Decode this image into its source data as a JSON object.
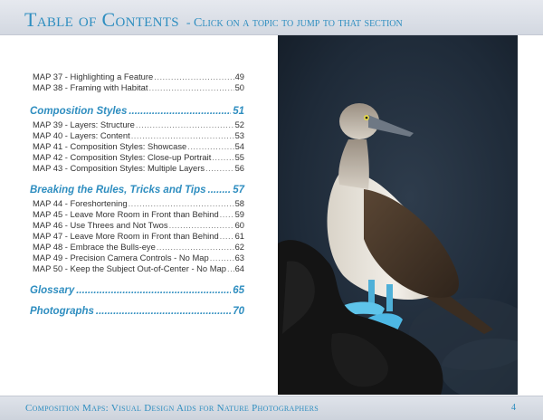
{
  "header": {
    "title": "Table of Contents",
    "subtitle": "- Click on a topic to jump to that section"
  },
  "toc": {
    "intro_entries": [
      {
        "label": "MAP 37 - Highlighting a Feature",
        "page": "49"
      },
      {
        "label": "MAP 38 - Framing with Habitat",
        "page": "50"
      }
    ],
    "sections": [
      {
        "title": "Composition Styles",
        "page": "51",
        "entries": [
          {
            "label": "MAP 39 - Layers: Structure",
            "page": "52"
          },
          {
            "label": "MAP 40 - Layers: Content",
            "page": "53"
          },
          {
            "label": "MAP 41 - Composition Styles: Showcase",
            "page": "54"
          },
          {
            "label": "MAP 42 - Composition Styles: Close-up Portrait",
            "page": "55"
          },
          {
            "label": "MAP 43 - Composition Styles: Multiple Layers",
            "page": "56"
          }
        ]
      },
      {
        "title": "Breaking the Rules, Tricks and Tips",
        "page": "57",
        "entries": [
          {
            "label": "MAP 44 - Foreshortening",
            "page": "58"
          },
          {
            "label": "MAP 45 - Leave More Room in Front than Behind",
            "page": "59"
          },
          {
            "label": "MAP 46 - Use Threes and Not Twos",
            "page": "60"
          },
          {
            "label": "MAP 47 - Leave More Room in Front than Behind",
            "page": "61"
          },
          {
            "label": "MAP 48 - Embrace the Bulls-eye",
            "page": "62"
          },
          {
            "label": "MAP 49 - Precision Camera Controls - No Map",
            "page": "63"
          },
          {
            "label": "MAP 50 - Keep the Subject Out-of-Center - No Map",
            "page": "64"
          }
        ]
      },
      {
        "title": "Glossary",
        "page": "65",
        "entries": []
      },
      {
        "title": "Photographs",
        "page": "70",
        "entries": []
      }
    ]
  },
  "footer": {
    "book_title": "Composition Maps: Visual Design Aids for Nature Photographers",
    "page_number": "4"
  },
  "colors": {
    "accent": "#2f8ec0",
    "header_bg": "#dde1e8",
    "photo_bg": "#1d2a38"
  }
}
